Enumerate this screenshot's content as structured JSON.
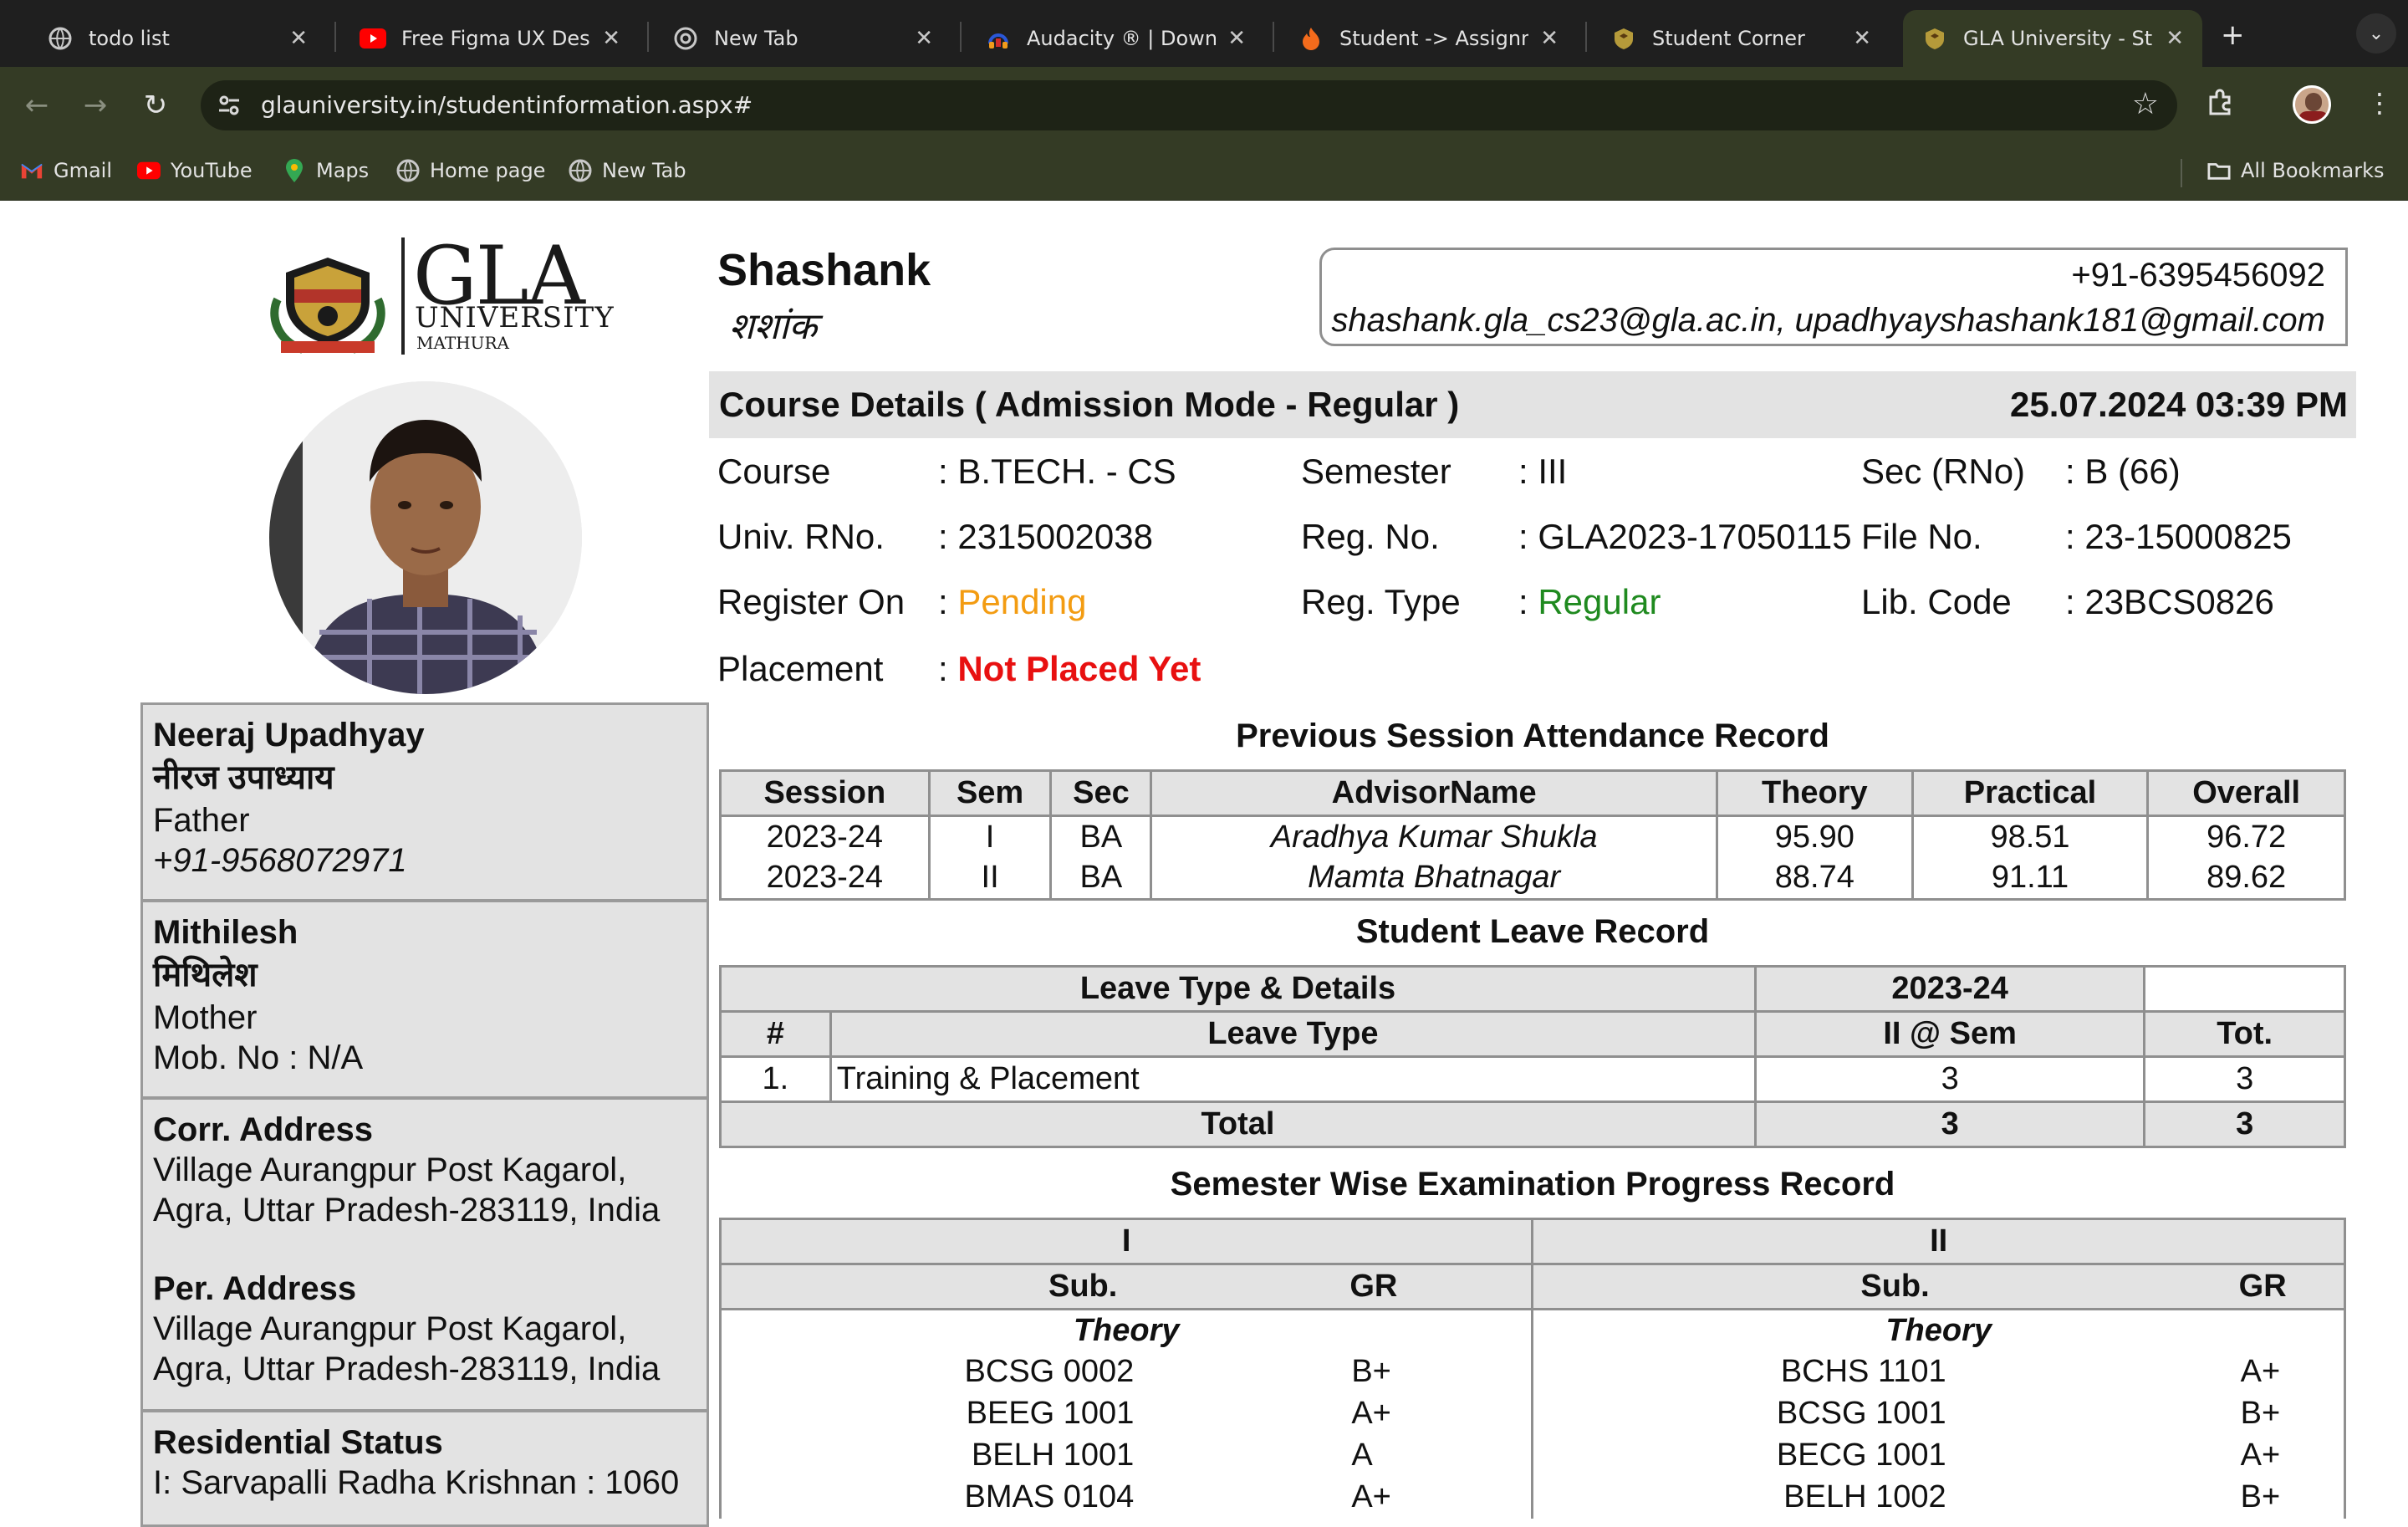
{
  "browser": {
    "tabs": [
      {
        "title": "todo list",
        "icon": "globe-icon"
      },
      {
        "title": "Free Figma UX Desig",
        "icon": "youtube-icon"
      },
      {
        "title": "New Tab",
        "icon": "chrome-icon"
      },
      {
        "title": "Audacity ® | Downlo",
        "icon": "audacity-icon"
      },
      {
        "title": "Student -> Assignm",
        "icon": "flame-icon"
      },
      {
        "title": "Student Corner",
        "icon": "gla-crest-icon"
      },
      {
        "title": "GLA University - Stu",
        "icon": "gla-crest-icon"
      }
    ],
    "url": "glauniversity.in/studentinformation.aspx#",
    "bookmarks": [
      "Gmail",
      "YouTube",
      "Maps",
      "Home page",
      "New Tab"
    ],
    "all_bookmarks": "All Bookmarks"
  },
  "logo": {
    "name": "GLA",
    "sub": "UNIVERSITY",
    "city": "MATHURA"
  },
  "student": {
    "name": "Shashank",
    "name_hindi": "शशांक",
    "phone": "+91-6395456092",
    "emails": "shashank.gla_cs23@gla.ac.in, upadhyayshashank181@gmail.com"
  },
  "family": {
    "father": {
      "name": "Neeraj Upadhyay",
      "name_hindi": "नीरज उपाध्याय",
      "relation": "Father",
      "phone": "+91-9568072971"
    },
    "mother": {
      "name": "Mithilesh",
      "name_hindi": "मिथिलेश",
      "relation": "Mother",
      "phone": "Mob. No : N/A"
    }
  },
  "address": {
    "corr_label": "Corr. Address",
    "corr_line1": "Village Aurangpur Post Kagarol,",
    "corr_line2": "Agra, Uttar Pradesh-283119, India",
    "per_label": "Per. Address",
    "per_line1": "Village Aurangpur Post Kagarol,",
    "per_line2": "Agra, Uttar Pradesh-283119, India"
  },
  "residential": {
    "label": "Residential Status",
    "value": "I: Sarvapalli Radha Krishnan : 1060"
  },
  "course": {
    "header": "Course Details  ( Admission Mode - Regular )",
    "datetime": "25.07.2024 03:39 PM",
    "course_label": "Course",
    "course": ": B.TECH. - CS",
    "semester_label": "Semester",
    "semester": ": III",
    "sec_label": "Sec (RNo)",
    "sec": ": B (66)",
    "univ_label": "Univ. RNo.",
    "univ": ": 2315002038",
    "reg_label": "Reg. No.",
    "reg": ": GLA2023-17050115",
    "file_label": "File No.",
    "file": ": 23-15000825",
    "register_label": "Register On",
    "register_colon": ": ",
    "register": "Pending",
    "regtype_label": "Reg. Type",
    "regtype_colon": ": ",
    "regtype": "Regular",
    "lib_label": "Lib. Code",
    "lib": ": 23BCS0826",
    "placement_label": "Placement",
    "placement_colon": ": ",
    "placement": "Not Placed Yet"
  },
  "attendance": {
    "title": "Previous Session Attendance Record",
    "headers": [
      "Session",
      "Sem",
      "Sec",
      "AdvisorName",
      "Theory",
      "Practical",
      "Overall"
    ],
    "rows": [
      [
        "2023-24",
        "I",
        "BA",
        "Aradhya Kumar Shukla",
        "95.90",
        "98.51",
        "96.72"
      ],
      [
        "2023-24",
        "II",
        "BA",
        "Mamta Bhatnagar",
        "88.74",
        "91.11",
        "89.62"
      ]
    ]
  },
  "leave": {
    "title": "Student Leave Record",
    "group_header": "Leave Type & Details",
    "session": "2023-24",
    "hash": "#",
    "type_header": "Leave Type",
    "sem_header": "II @ Sem",
    "tot_header": "Tot.",
    "row": {
      "num": "1.",
      "type": "Training & Placement",
      "sem": "3",
      "tot": "3"
    },
    "total": {
      "label": "Total",
      "sem": "3",
      "tot": "3"
    }
  },
  "exam": {
    "title": "Semester Wise Examination Progress Record",
    "sem1": "I",
    "sem2": "II",
    "sub": "Sub.",
    "gr": "GR",
    "theory": "Theory",
    "sem1_rows": [
      [
        "BCSG 0002",
        "B+"
      ],
      [
        "BEEG 1001",
        "A+"
      ],
      [
        "BELH 1001",
        "A"
      ],
      [
        "BMAS 0104",
        "A+"
      ]
    ],
    "sem2_rows": [
      [
        "BCHS 1101",
        "A+"
      ],
      [
        "BCSG 1001",
        "B+"
      ],
      [
        "BECG 1001",
        "A+"
      ],
      [
        "BELH 1002",
        "B+"
      ]
    ]
  }
}
